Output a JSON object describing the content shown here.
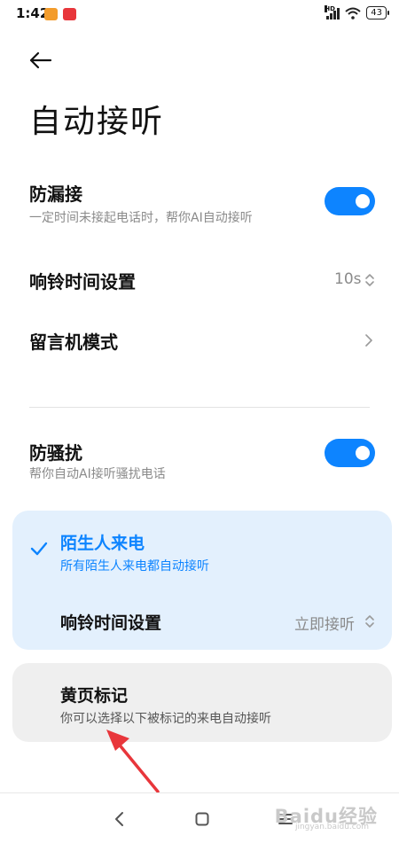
{
  "status_bar": {
    "time": "1:42",
    "battery": "43",
    "network": "HD"
  },
  "header": {
    "title": "自动接听"
  },
  "leak_answer": {
    "title": "防漏接",
    "subtitle": "一定时间未接起电话时，帮你AI自动接听",
    "enabled": true
  },
  "ring_time": {
    "label": "响铃时间设置",
    "value": "10s"
  },
  "voicemail": {
    "label": "留言机模式"
  },
  "anti_harass": {
    "title": "防骚扰",
    "subtitle": "帮你自动AI接听骚扰电话",
    "enabled": true
  },
  "stranger_card": {
    "title": "陌生人来电",
    "subtitle": "所有陌生人来电都自动接听",
    "selected": true,
    "ring_label": "响铃时间设置",
    "ring_value": "立即接听"
  },
  "yellow_pages_card": {
    "title": "黄页标记",
    "subtitle": "你可以选择以下被标记的来电自动接听"
  },
  "watermark": {
    "text": "Baidu经验",
    "sub": "jingyan.baidu.com"
  },
  "colors": {
    "accent": "#0d84ff",
    "card_blue": "#e3f0fd",
    "card_gray": "#efefef",
    "arrow": "#e8363b"
  },
  "icons": [
    "back-arrow-icon",
    "chevron-up-down-icon",
    "chevron-right-icon",
    "check-icon",
    "nav-back-icon",
    "nav-home-icon",
    "nav-menu-icon"
  ]
}
